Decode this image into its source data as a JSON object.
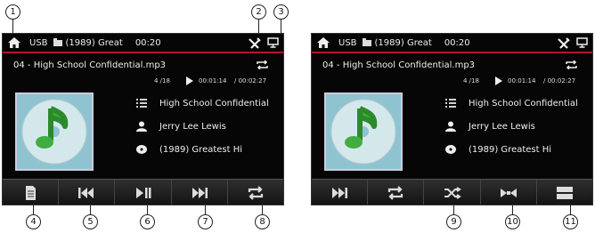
{
  "callouts": {
    "c1": "1",
    "c2": "2",
    "c3": "3",
    "c4": "4",
    "c5": "5",
    "c6": "6",
    "c7": "7",
    "c8": "8",
    "c9": "9",
    "c10": "10",
    "c11": "11"
  },
  "screen_left": {
    "topbar": {
      "source": "USB",
      "album": "(1989) Great",
      "time": "00:20",
      "home_icon": "home-icon",
      "settings_icon": "settings-icon",
      "display_icon": "display-icon",
      "folder_icon": "folder-icon"
    },
    "filename": "04 - High School Confidential.mp3",
    "track_counter": "4 /18",
    "elapsed": "00:01:14",
    "total": "/ 00:02:27",
    "title": "High School Confidential",
    "artist": "Jerry Lee Lewis",
    "album_info": "(1989) Greatest Hi",
    "toolbar": [
      "list-icon",
      "previous-icon",
      "play-pause-icon",
      "next-icon",
      "repeat-icon"
    ]
  },
  "screen_right": {
    "topbar": {
      "source": "USB",
      "album": "(1989) Great",
      "time": "00:20",
      "home_icon": "home-icon",
      "settings_icon": "settings-icon",
      "display_icon": "display-icon",
      "folder_icon": "folder-icon"
    },
    "filename": "04 - High School Confidential.mp3",
    "track_counter": "4 /18",
    "elapsed": "00:01:14",
    "total": "/ 00:02:27",
    "title": "High School Confidential",
    "artist": "Jerry Lee Lewis",
    "album_info": "(1989) Greatest Hi",
    "toolbar": [
      "next-icon",
      "repeat-icon",
      "shuffle-icon",
      "eq-icon",
      "menu-icon"
    ]
  },
  "colors": {
    "accent": "#b8102a",
    "screen_bg": "#060606",
    "art_bg": "#8fc3cf"
  }
}
